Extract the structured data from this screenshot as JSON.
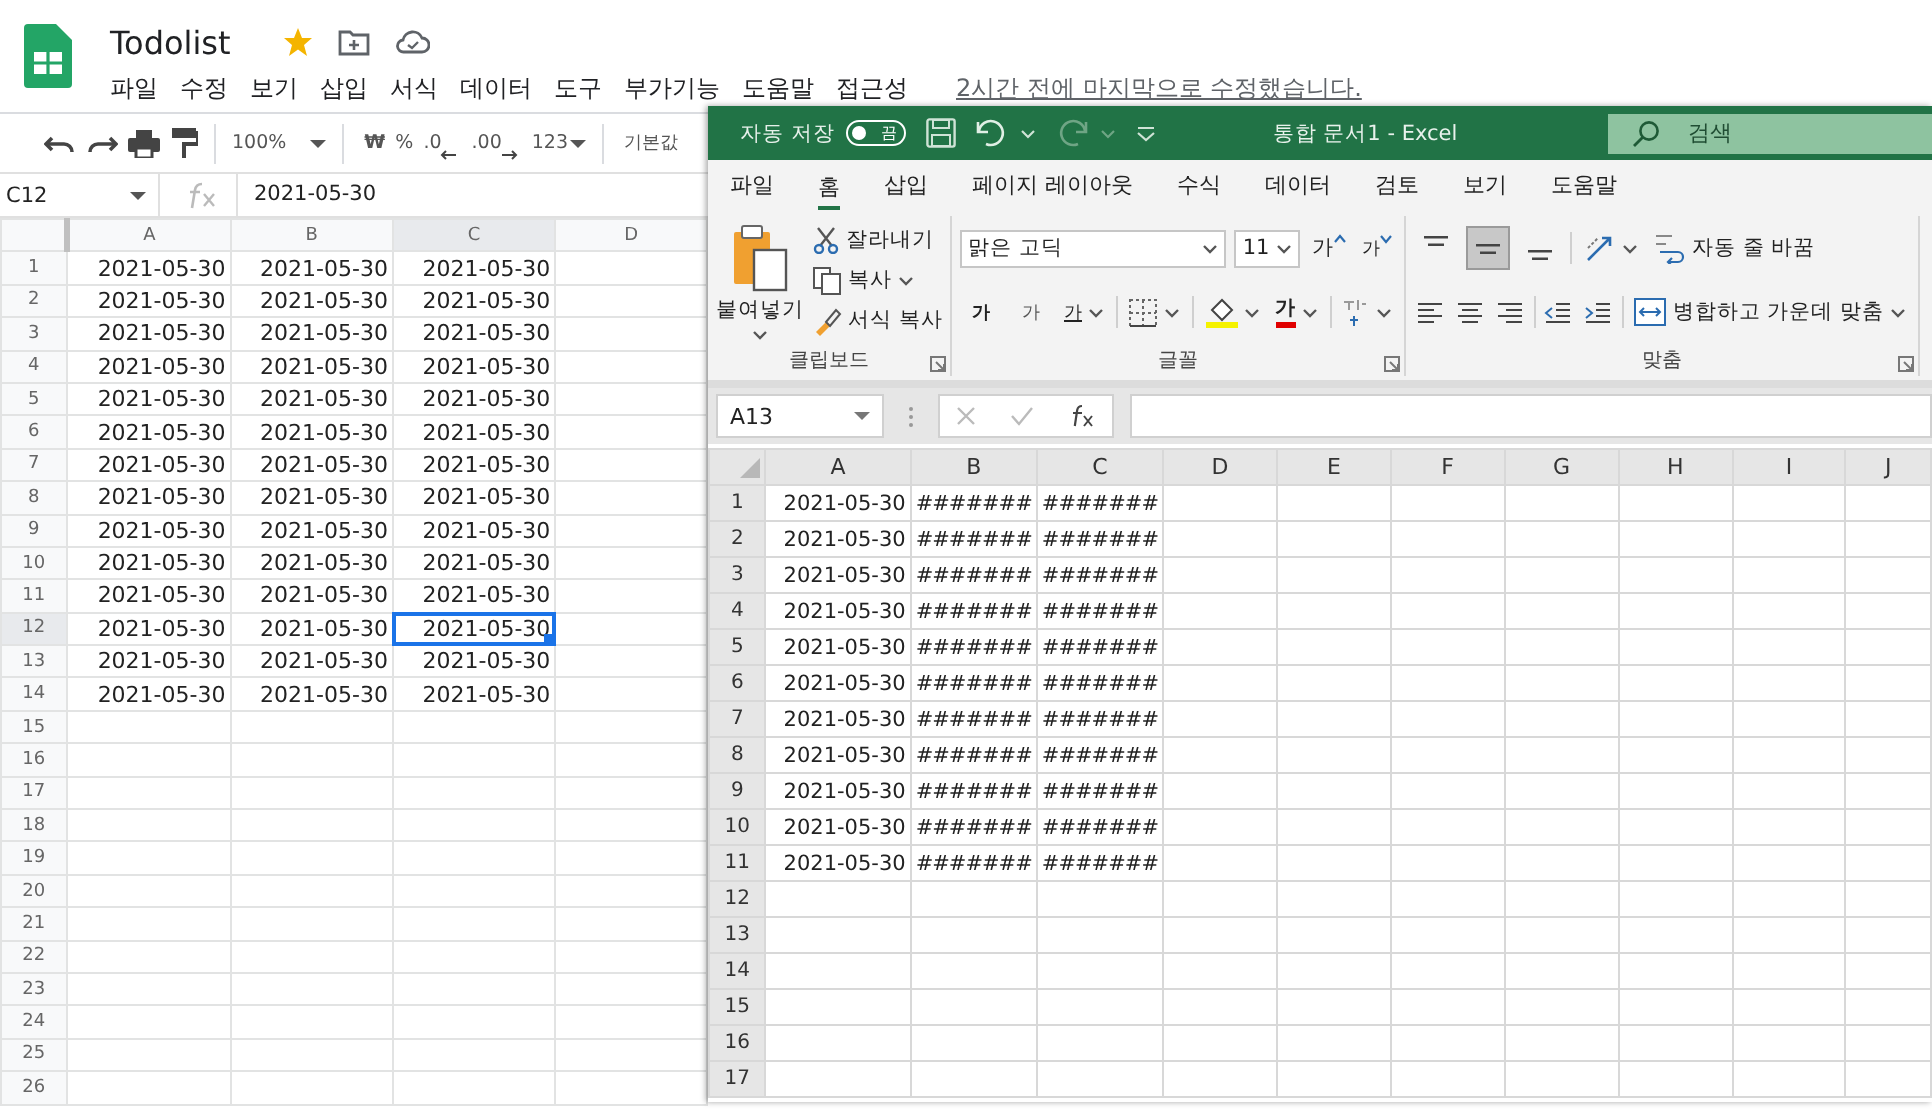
{
  "sheets": {
    "title": "Todolist",
    "starred": true,
    "menu": [
      "파일",
      "수정",
      "보기",
      "삽입",
      "서식",
      "데이터",
      "도구",
      "부가기능",
      "도움말",
      "접근성"
    ],
    "last_edit": "2시간 전에 마지막으로 수정했습니다.",
    "toolbar": {
      "zoom": "100%",
      "currency": "₩",
      "percent": "%",
      "decrease_decimals": ".0",
      "increase_decimals": ".00",
      "number_format": "123",
      "font": "기본값"
    },
    "name_box": "C12",
    "formula": "2021-05-30",
    "columns": [
      {
        "label": "A",
        "selected": false
      },
      {
        "label": "B",
        "selected": false
      },
      {
        "label": "C",
        "selected": true
      },
      {
        "label": "D",
        "selected": false
      }
    ],
    "rows": [
      {
        "label": "1",
        "selected": false,
        "cells": [
          "2021-05-30",
          "2021-05-30",
          "2021-05-30"
        ]
      },
      {
        "label": "2",
        "selected": false,
        "cells": [
          "2021-05-30",
          "2021-05-30",
          "2021-05-30"
        ]
      },
      {
        "label": "3",
        "selected": false,
        "cells": [
          "2021-05-30",
          "2021-05-30",
          "2021-05-30"
        ]
      },
      {
        "label": "4",
        "selected": false,
        "cells": [
          "2021-05-30",
          "2021-05-30",
          "2021-05-30"
        ]
      },
      {
        "label": "5",
        "selected": false,
        "cells": [
          "2021-05-30",
          "2021-05-30",
          "2021-05-30"
        ]
      },
      {
        "label": "6",
        "selected": false,
        "cells": [
          "2021-05-30",
          "2021-05-30",
          "2021-05-30"
        ]
      },
      {
        "label": "7",
        "selected": false,
        "cells": [
          "2021-05-30",
          "2021-05-30",
          "2021-05-30"
        ]
      },
      {
        "label": "8",
        "selected": false,
        "cells": [
          "2021-05-30",
          "2021-05-30",
          "2021-05-30"
        ]
      },
      {
        "label": "9",
        "selected": false,
        "cells": [
          "2021-05-30",
          "2021-05-30",
          "2021-05-30"
        ]
      },
      {
        "label": "10",
        "selected": false,
        "cells": [
          "2021-05-30",
          "2021-05-30",
          "2021-05-30"
        ]
      },
      {
        "label": "11",
        "selected": false,
        "cells": [
          "2021-05-30",
          "2021-05-30",
          "2021-05-30"
        ]
      },
      {
        "label": "12",
        "selected": true,
        "cells": [
          "2021-05-30",
          "2021-05-30",
          "2021-05-30"
        ]
      },
      {
        "label": "13",
        "selected": false,
        "cells": [
          "2021-05-30",
          "2021-05-30",
          "2021-05-30"
        ]
      },
      {
        "label": "14",
        "selected": false,
        "cells": [
          "2021-05-30",
          "2021-05-30",
          "2021-05-30"
        ]
      },
      {
        "label": "15",
        "selected": false
      },
      {
        "label": "16",
        "selected": false
      },
      {
        "label": "17",
        "selected": false
      },
      {
        "label": "18",
        "selected": false
      },
      {
        "label": "19",
        "selected": false
      },
      {
        "label": "20",
        "selected": false
      },
      {
        "label": "21",
        "selected": false
      },
      {
        "label": "22",
        "selected": false
      },
      {
        "label": "23",
        "selected": false
      },
      {
        "label": "24",
        "selected": false
      },
      {
        "label": "25",
        "selected": false
      },
      {
        "label": "26",
        "selected": false
      }
    ]
  },
  "excel": {
    "autosave": {
      "label": "자동 저장",
      "on": false,
      "state_text": "끔"
    },
    "title": "통합 문서1 - Excel",
    "search_placeholder": "검색",
    "tabs": [
      {
        "label": "파일",
        "selected": false
      },
      {
        "label": "홈",
        "selected": true
      },
      {
        "label": "삽입",
        "selected": false
      },
      {
        "label": "페이지 레이아웃",
        "selected": false
      },
      {
        "label": "수식",
        "selected": false
      },
      {
        "label": "데이터",
        "selected": false
      },
      {
        "label": "검토",
        "selected": false
      },
      {
        "label": "보기",
        "selected": false
      },
      {
        "label": "도움말",
        "selected": false
      }
    ],
    "clipboard": {
      "paste": "붙여넣기",
      "cut": "잘라내기",
      "copy": "복사",
      "format_painter": "서식 복사",
      "label": "클립보드"
    },
    "font": {
      "name": "맑은 고딕",
      "size": "11",
      "grow": "가",
      "shrink": "가",
      "bold": "가",
      "italic": "가",
      "underline": "가",
      "font_color": "가",
      "label": "글꼴"
    },
    "alignment": {
      "vertical": [
        {
          "kind": "top",
          "selected": false
        },
        {
          "kind": "middle",
          "selected": true
        },
        {
          "kind": "bottom",
          "selected": false
        }
      ],
      "wrap": "자동 줄 바꿈",
      "merge": "병합하고 가운데 맞춤",
      "label": "맞춤"
    },
    "name_box": "A13",
    "columns": [
      "A",
      "B",
      "C",
      "D",
      "E",
      "F",
      "G",
      "H",
      "I",
      "J"
    ],
    "rows": [
      {
        "label": "1",
        "cells": [
          "2021-05-30",
          "#######",
          "#######"
        ]
      },
      {
        "label": "2",
        "cells": [
          "2021-05-30",
          "#######",
          "#######"
        ]
      },
      {
        "label": "3",
        "cells": [
          "2021-05-30",
          "#######",
          "#######"
        ]
      },
      {
        "label": "4",
        "cells": [
          "2021-05-30",
          "#######",
          "#######"
        ]
      },
      {
        "label": "5",
        "cells": [
          "2021-05-30",
          "#######",
          "#######"
        ]
      },
      {
        "label": "6",
        "cells": [
          "2021-05-30",
          "#######",
          "#######"
        ]
      },
      {
        "label": "7",
        "cells": [
          "2021-05-30",
          "#######",
          "#######"
        ]
      },
      {
        "label": "8",
        "cells": [
          "2021-05-30",
          "#######",
          "#######"
        ]
      },
      {
        "label": "9",
        "cells": [
          "2021-05-30",
          "#######",
          "#######"
        ]
      },
      {
        "label": "10",
        "cells": [
          "2021-05-30",
          "#######",
          "#######"
        ]
      },
      {
        "label": "11",
        "cells": [
          "2021-05-30",
          "#######",
          "#######"
        ]
      },
      {
        "label": "12"
      },
      {
        "label": "13"
      },
      {
        "label": "14"
      },
      {
        "label": "15"
      },
      {
        "label": "16"
      },
      {
        "label": "17"
      }
    ]
  }
}
